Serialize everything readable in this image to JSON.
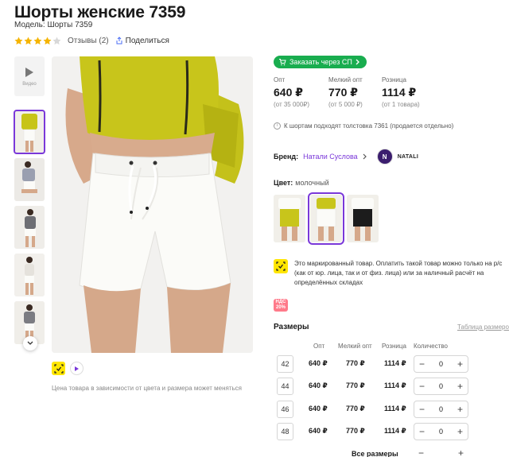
{
  "product": {
    "title": "Шорты женские 7359",
    "model": "Модель: Шорты 7359",
    "rating": 4,
    "reviews": "Отзывы (2)",
    "share": "Поделиться"
  },
  "gallery": {
    "video_label": "Видео",
    "price_note": "Цена товара в зависимости от цвета и размера может меняться"
  },
  "order_button": "Заказать через СП",
  "prices": [
    {
      "caption": "Опт",
      "value": "640 ₽",
      "sub": "(от 35 000₽)"
    },
    {
      "caption": "Мелкий опт",
      "value": "770 ₽",
      "sub": "(от 5 000 ₽)"
    },
    {
      "caption": "Розница",
      "value": "1114 ₽",
      "sub": "(от 1 товара)"
    }
  ],
  "hint": "К шортам подходят толстовка 7361 (продается отдельно)",
  "brand": {
    "label": "Бренд:",
    "name": "Натали Суслова",
    "logo_text": "NATALI"
  },
  "color": {
    "label": "Цвет:",
    "value": "молочный"
  },
  "marking_text": "Это маркированный товар. Оплатить такой товар можно только на р/с (как от юр. лица, так и от физ. лица) или за наличный расчёт на определённых складах",
  "nds_badge": [
    "НДС",
    "20%"
  ],
  "sizes": {
    "title": "Размеры",
    "table_link": "Таблица размеров",
    "headers": [
      "Опт",
      "Мелкий опт",
      "Розница",
      "Количество"
    ],
    "rows": [
      {
        "size": "42",
        "opt": "640 ₽",
        "small": "770 ₽",
        "retail": "1114 ₽",
        "qty": "0"
      },
      {
        "size": "44",
        "opt": "640 ₽",
        "small": "770 ₽",
        "retail": "1114 ₽",
        "qty": "0"
      },
      {
        "size": "46",
        "opt": "640 ₽",
        "small": "770 ₽",
        "retail": "1114 ₽",
        "qty": "0"
      },
      {
        "size": "48",
        "opt": "640 ₽",
        "small": "770 ₽",
        "retail": "1114 ₽",
        "qty": "0"
      }
    ],
    "all_sizes": "Все размеры"
  },
  "colors": {
    "accent": "#7a38d9",
    "green": "#19ad4f",
    "star": "#f5b400",
    "mustard": "#c7c418"
  }
}
